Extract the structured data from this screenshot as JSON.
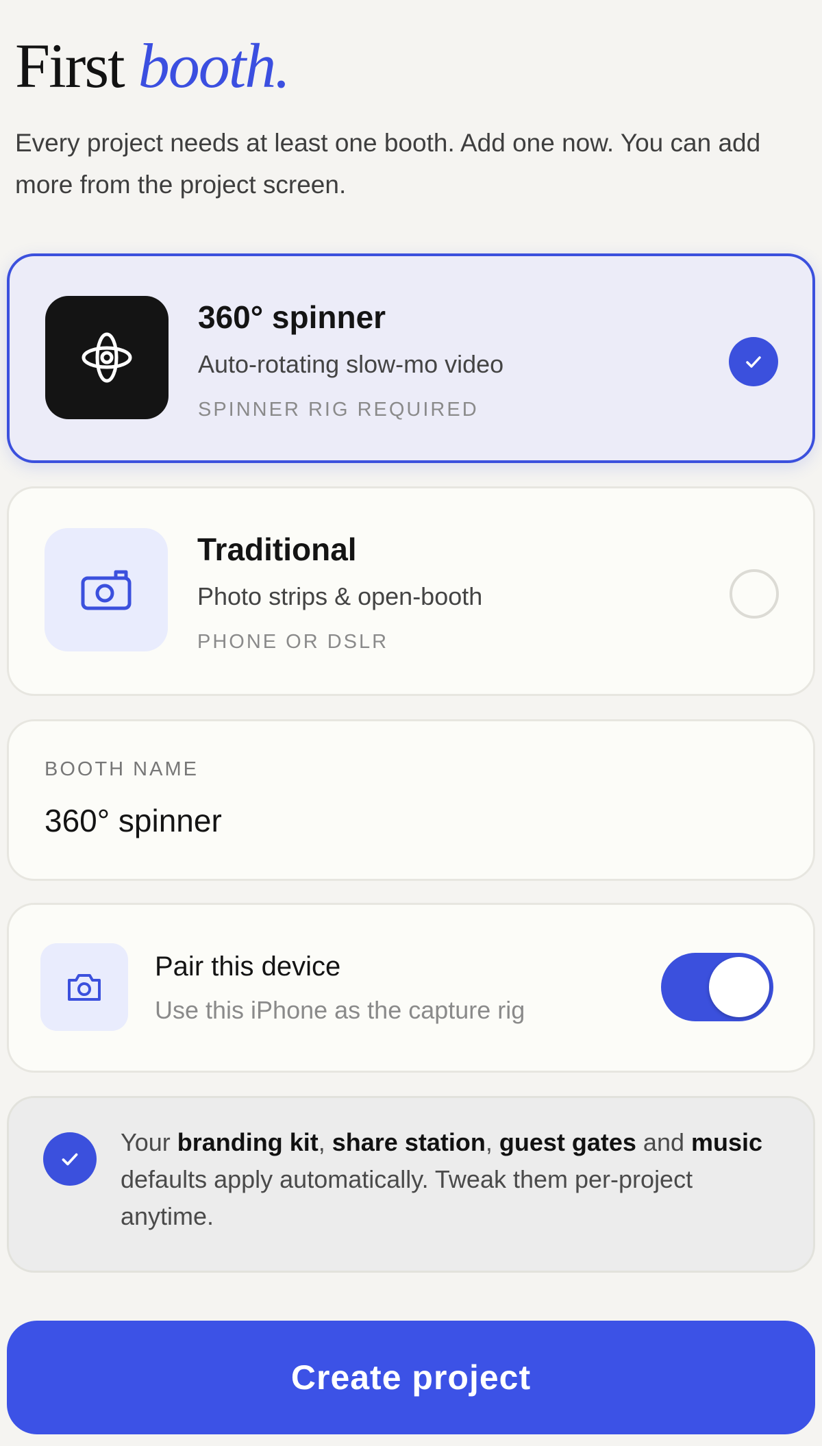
{
  "header": {
    "title_plain": "First ",
    "title_accent": "booth.",
    "subtitle": "Every project needs at least one booth. Add one now. You can add more from the project screen."
  },
  "booth_options": [
    {
      "title": "360° spinner",
      "description": "Auto-rotating slow-mo video",
      "requirement": "SPINNER RIG REQUIRED",
      "icon": "spinner-icon",
      "selected": true
    },
    {
      "title": "Traditional",
      "description": "Photo strips & open-booth",
      "requirement": "PHONE OR DSLR",
      "icon": "camera-icon",
      "selected": false
    }
  ],
  "booth_name": {
    "label": "BOOTH NAME",
    "value": "360° spinner"
  },
  "pair_device": {
    "title": "Pair this device",
    "subtitle": "Use this iPhone as the capture rig",
    "icon": "camera-icon",
    "enabled": true
  },
  "defaults_info": {
    "t1": "Your ",
    "b1": "branding kit",
    "t2": ", ",
    "b2": "share station",
    "t3": ", ",
    "b3": "guest gates",
    "t4": " and ",
    "b4": "music",
    "t5": " defaults apply automatically. Tweak them per-project anytime."
  },
  "cta": {
    "label": "Create project"
  },
  "colors": {
    "accent": "#3b50dd",
    "background": "#f5f4f1",
    "card": "#fcfcf8"
  }
}
